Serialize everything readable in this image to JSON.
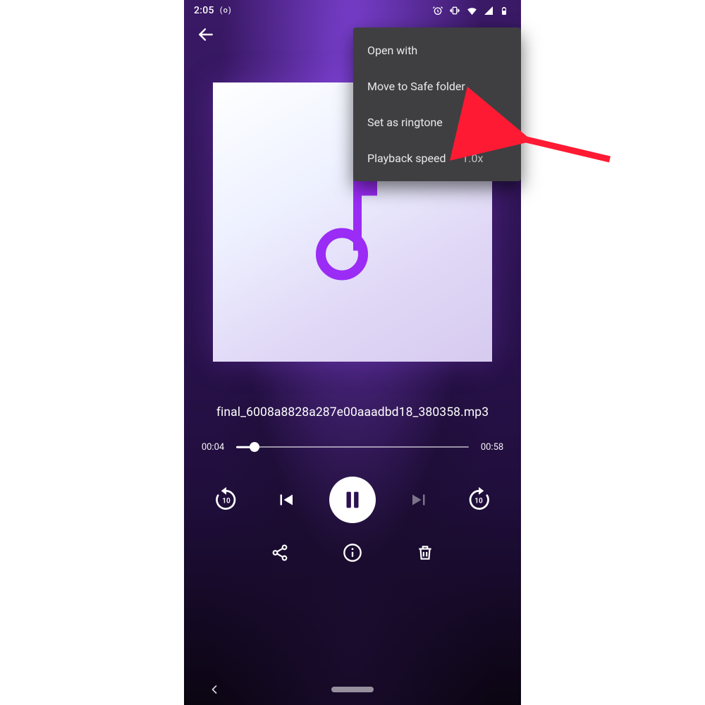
{
  "status": {
    "time": "2:05",
    "record": "(o)"
  },
  "menu": {
    "open_with": "Open with",
    "move_safe": "Move to Safe folder",
    "ringtone": "Set as ringtone",
    "speed_label": "Playback speed",
    "speed_value": "1.0x"
  },
  "player": {
    "filename": "final_6008a8828a287e00aaadbd18_380358.mp3",
    "elapsed": "00:04",
    "duration": "00:58",
    "progress_pct": 8,
    "rewind_seconds": "10",
    "forward_seconds": "10"
  },
  "annotation": {
    "target": "menu-item-set-ringtone"
  }
}
